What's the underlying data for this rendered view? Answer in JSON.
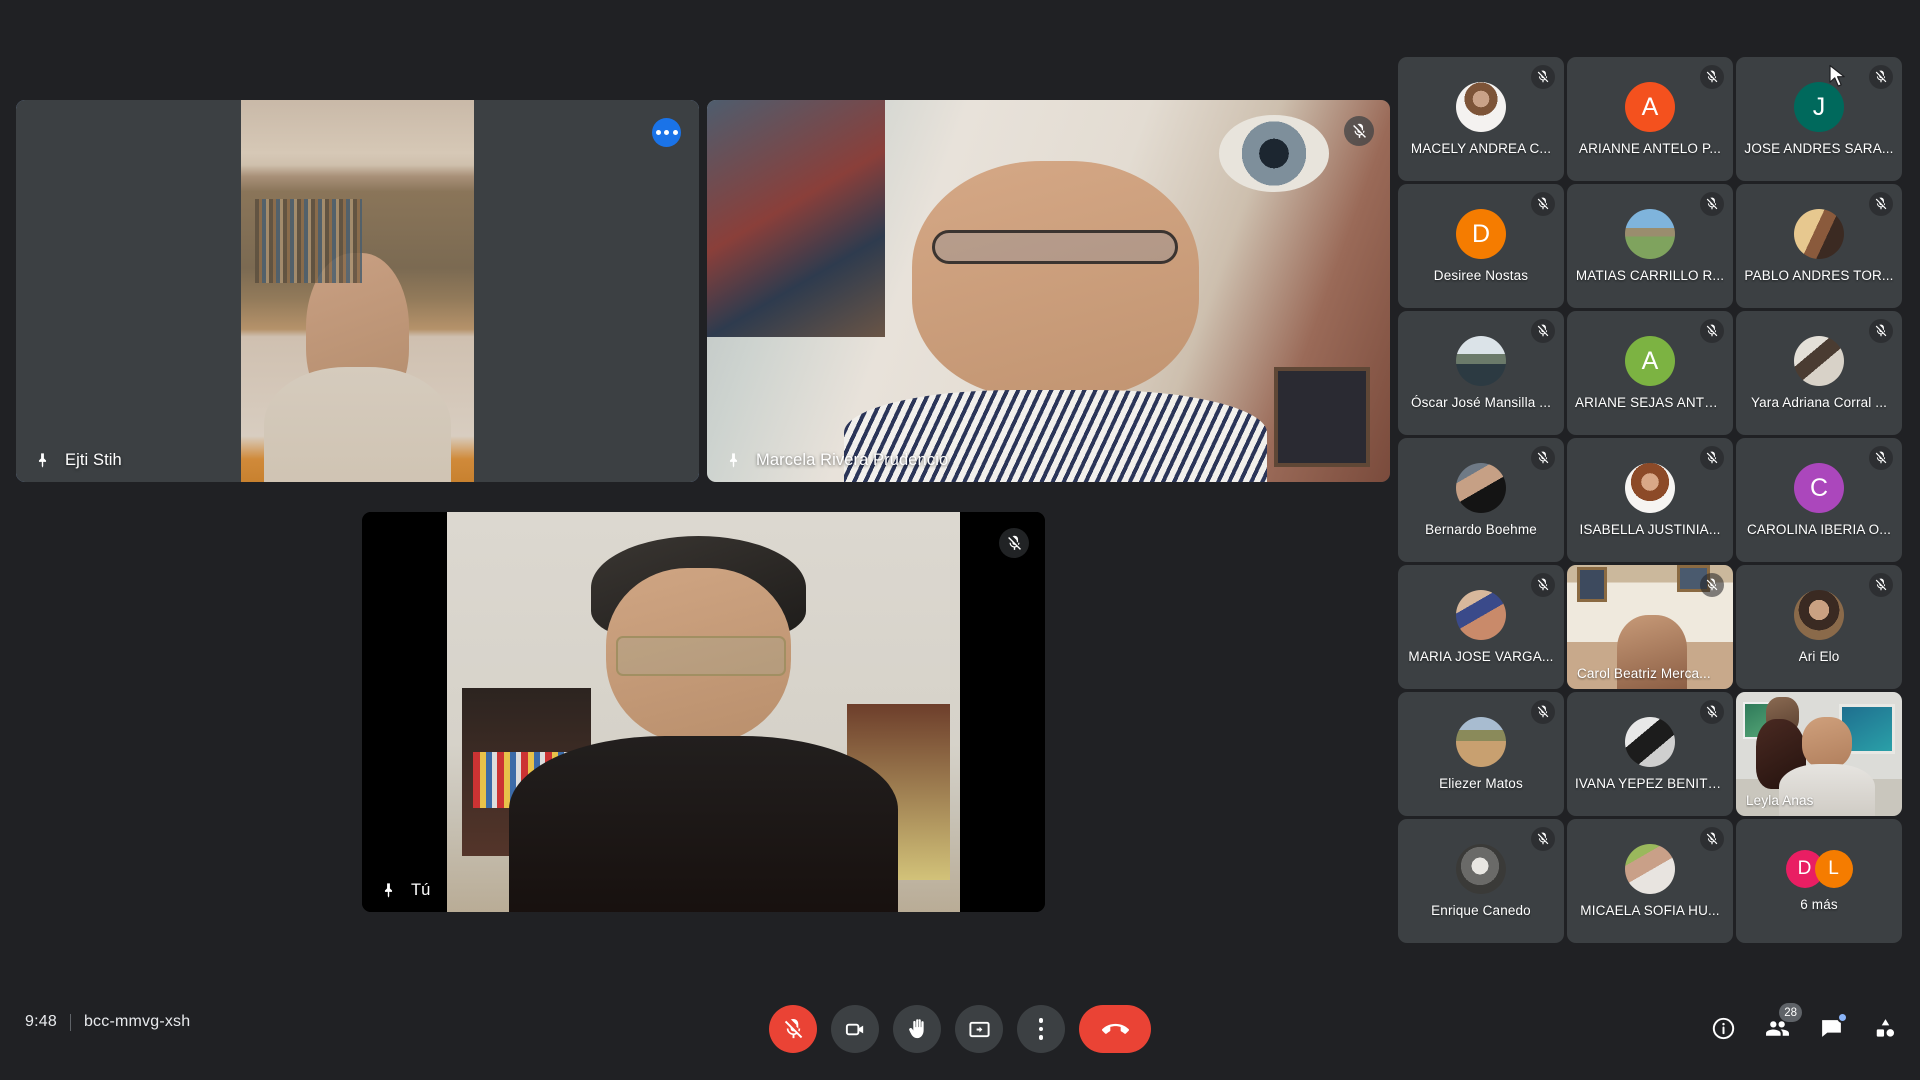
{
  "meeting": {
    "time": "9:48",
    "code": "bcc-mmvg-xsh",
    "participant_count": "28",
    "overflow_label": "6 más"
  },
  "main_tiles": [
    {
      "name": "Ejti Stih",
      "pin_icon": "pin-icon",
      "more_icon": "more-options-icon",
      "muted": false,
      "active_speaker": true
    },
    {
      "name": "Marcela Rivera Prudencio",
      "pin_icon": "pin-icon",
      "mic_icon": "mic-off-icon",
      "muted": true,
      "active_speaker": false
    },
    {
      "name": "Tú",
      "pin_icon": "pin-icon",
      "mic_icon": "mic-off-icon",
      "muted": true,
      "active_speaker": false
    }
  ],
  "participants": [
    {
      "name": "MACELY ANDREA C...",
      "kind": "photo",
      "photo": "ph-macely",
      "muted": true
    },
    {
      "name": "ARIANNE ANTELO P...",
      "kind": "initial",
      "initial": "A",
      "color": "#f4511e",
      "muted": true
    },
    {
      "name": "JOSE ANDRES SARA...",
      "kind": "initial",
      "initial": "J",
      "color": "#00695c",
      "muted": true
    },
    {
      "name": "Desiree Nostas",
      "kind": "initial",
      "initial": "D",
      "color": "#f57c00",
      "muted": true
    },
    {
      "name": "MATIAS CARRILLO R...",
      "kind": "photo",
      "photo": "ph-matias",
      "muted": true
    },
    {
      "name": "PABLO ANDRES TOR...",
      "kind": "photo",
      "photo": "ph-pablo",
      "muted": true
    },
    {
      "name": "Óscar José Mansilla ...",
      "kind": "photo",
      "photo": "ph-oscar",
      "muted": true
    },
    {
      "name": "ARIANE SEJAS ANTE...",
      "kind": "initial",
      "initial": "A",
      "color": "#7cb342",
      "muted": true
    },
    {
      "name": "Yara Adriana Corral ...",
      "kind": "photo",
      "photo": "ph-yara",
      "muted": true
    },
    {
      "name": "Bernardo Boehme",
      "kind": "photo",
      "photo": "ph-bernardo",
      "muted": true
    },
    {
      "name": "ISABELLA JUSTINIA...",
      "kind": "photo",
      "photo": "ph-isabella",
      "muted": true
    },
    {
      "name": "CAROLINA IBERIA O...",
      "kind": "initial",
      "initial": "C",
      "color": "#ab47bc",
      "muted": true
    },
    {
      "name": "MARIA JOSE VARGA...",
      "kind": "photo",
      "photo": "ph-mariajose",
      "muted": true
    },
    {
      "name": "Carol Beatriz Merca...",
      "kind": "video",
      "video": "vb-carol",
      "muted": true
    },
    {
      "name": "Ari Elo",
      "kind": "photo",
      "photo": "ph-ari",
      "muted": true
    },
    {
      "name": "Eliezer Matos",
      "kind": "photo",
      "photo": "ph-eliezer",
      "muted": true
    },
    {
      "name": "IVANA YEPEZ BENITEZ",
      "kind": "photo",
      "photo": "ph-ivana",
      "muted": true
    },
    {
      "name": "Leyla Anas",
      "kind": "video",
      "video": "vb-leyla",
      "muted": false
    },
    {
      "name": "Enrique Canedo",
      "kind": "photo",
      "photo": "ph-enrique",
      "muted": true
    },
    {
      "name": "MICAELA SOFIA HU...",
      "kind": "photo",
      "photo": "ph-micaela",
      "muted": true
    },
    {
      "name": "6 más",
      "kind": "overflow",
      "overflow": [
        {
          "initial": "D",
          "color": "#e91e63"
        },
        {
          "initial": "L",
          "color": "#f57c00"
        }
      ],
      "muted": false
    }
  ],
  "controls": [
    {
      "id": "microphone",
      "label": "Desactivar micrófono",
      "icon": "mic-off-icon",
      "state": "muted"
    },
    {
      "id": "camera",
      "label": "Desactivar cámara",
      "icon": "video-camera-icon",
      "state": "on"
    },
    {
      "id": "raise-hand",
      "label": "Levantar la mano",
      "icon": "raised-hand-icon",
      "state": "off"
    },
    {
      "id": "present",
      "label": "Presentar ahora",
      "icon": "present-screen-icon",
      "state": "off"
    },
    {
      "id": "more",
      "label": "Más opciones",
      "icon": "more-vertical-icon",
      "state": "off"
    },
    {
      "id": "hangup",
      "label": "Salir de la llamada",
      "icon": "end-call-icon",
      "state": "danger"
    }
  ],
  "right_controls": [
    {
      "id": "details",
      "label": "Detalles de la reunión",
      "icon": "info-icon",
      "badge": ""
    },
    {
      "id": "participants",
      "label": "Mostrar a todos",
      "icon": "people-icon",
      "badge": "28"
    },
    {
      "id": "chat",
      "label": "Chat con todos",
      "icon": "chat-bubble-icon",
      "badge": "dot"
    },
    {
      "id": "activities",
      "label": "Actividades",
      "icon": "activities-icon",
      "badge": ""
    }
  ],
  "colors": {
    "background": "#202124",
    "tile": "#3c4043",
    "accent_blue": "#8ab4f8",
    "action_blue": "#1a73e8",
    "danger_red": "#ea4335"
  }
}
